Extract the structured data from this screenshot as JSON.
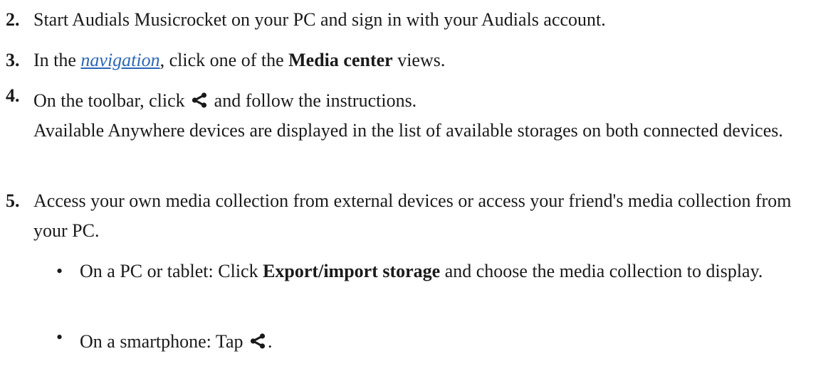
{
  "steps": [
    {
      "number": "2.",
      "text": "Start Audials Musicrocket on your PC and sign in with your Audials account."
    },
    {
      "number": "3.",
      "pre": "In the ",
      "link": "navigation",
      "mid": ", click one of the ",
      "bold": "Media center",
      "post": " views."
    },
    {
      "number": "4.",
      "pre": "On the toolbar, click ",
      "icon": "share-icon",
      "post": " and follow the instructions.",
      "note": "Available Anywhere devices are displayed in the list of available storages on both connected devices."
    },
    {
      "number": "5.",
      "text": "Access your own media collection from external devices or access your friend's media collection from your PC."
    }
  ],
  "bullets": [
    {
      "marker": "•",
      "pre": "On a PC or tablet: Click ",
      "bold": "Export/import storage",
      "post": " and choose the media collection to display."
    },
    {
      "marker": "•",
      "pre": "On a smartphone: Tap ",
      "icon": "share-icon",
      "post": "."
    }
  ]
}
